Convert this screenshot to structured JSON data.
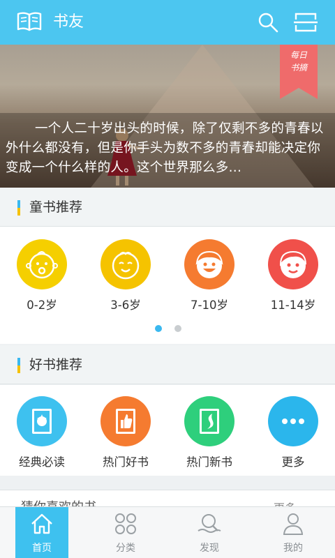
{
  "appbar": {
    "title": "书友",
    "icons": [
      "open-book-icon",
      "search-icon",
      "scan-icon"
    ],
    "color": "#4cc6f0"
  },
  "banner": {
    "quote": "一个人二十岁出头的时候，除了仅剩不多的青春以外什么都没有，但是你手头为数不多的青春却能决定你变成一个什么样的人。这个世界那么多...",
    "ribbon_line1": "每日",
    "ribbon_line2": "书摘",
    "ribbon_color": "#ef6b6b"
  },
  "kids_section": {
    "title": "童书推荐",
    "items": [
      {
        "label": "0-2岁",
        "color": "#f5cf00",
        "icon": "baby-face-icon"
      },
      {
        "label": "3-6岁",
        "color": "#f5c300",
        "icon": "smiling-child-face-icon"
      },
      {
        "label": "7-10岁",
        "color": "#f57b30",
        "icon": "grinning-boy-face-icon"
      },
      {
        "label": "11-14岁",
        "color": "#f0504a",
        "icon": "teen-face-icon"
      }
    ],
    "pager": {
      "count": 2,
      "active": 0,
      "active_color": "#3ab8ef",
      "inactive_color": "#c9cdd0"
    }
  },
  "books_section": {
    "title": "好书推荐",
    "items": [
      {
        "label": "经典必读",
        "color": "#3ec1ef",
        "icon": "classic-book-icon"
      },
      {
        "label": "热门好书",
        "color": "#f57b30",
        "icon": "thumbs-up-book-icon"
      },
      {
        "label": "热门新书",
        "color": "#2ecf7c",
        "icon": "new-book-icon"
      },
      {
        "label": "更多",
        "color": "#2bb6ec",
        "icon": "more-dots-icon"
      }
    ]
  },
  "next_section": {
    "title": "猜你喜欢的书",
    "more": "更多"
  },
  "tabbar": {
    "active_color": "#3ec1ef",
    "tabs": [
      {
        "label": "首页",
        "icon": "home-icon",
        "active": true
      },
      {
        "label": "分类",
        "icon": "category-grid-icon",
        "active": false
      },
      {
        "label": "发现",
        "icon": "discover-icon",
        "active": false
      },
      {
        "label": "我的",
        "icon": "profile-icon",
        "active": false
      }
    ]
  }
}
